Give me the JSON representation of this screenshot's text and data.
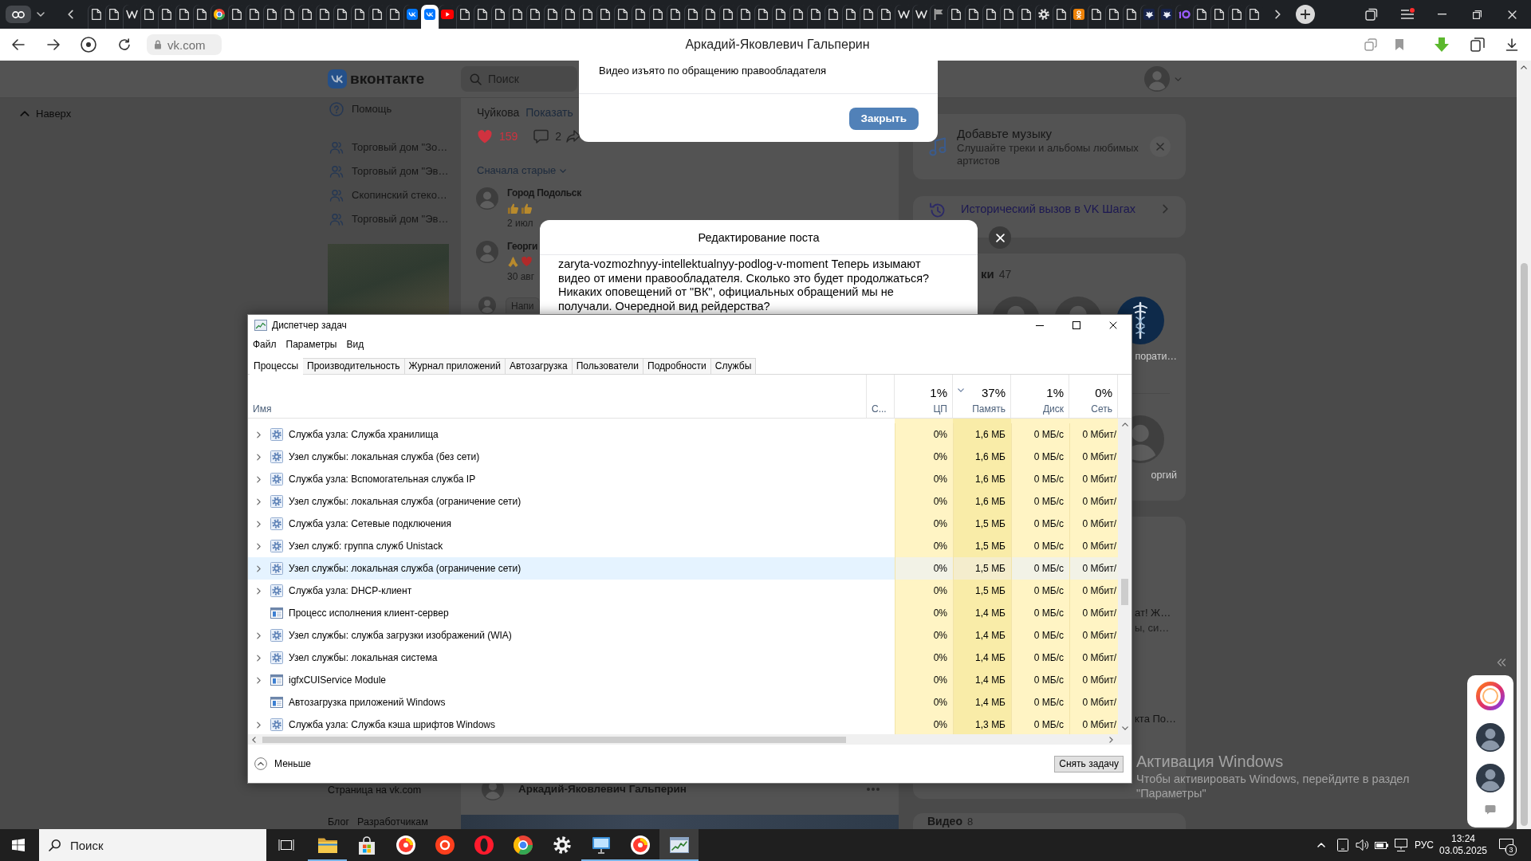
{
  "browser": {
    "tabs": [
      {
        "kind": "page",
        "selected": false
      },
      {
        "kind": "page",
        "selected": false
      },
      {
        "kind": "wiki",
        "selected": false
      },
      {
        "kind": "page",
        "selected": false
      },
      {
        "kind": "page",
        "selected": false
      },
      {
        "kind": "page",
        "selected": false
      },
      {
        "kind": "page",
        "selected": false
      },
      {
        "kind": "color",
        "selected": false
      },
      {
        "kind": "page",
        "selected": false
      },
      {
        "kind": "page",
        "selected": false
      },
      {
        "kind": "page",
        "selected": false
      },
      {
        "kind": "page",
        "selected": false
      },
      {
        "kind": "page",
        "selected": false
      },
      {
        "kind": "page",
        "selected": false
      },
      {
        "kind": "page",
        "selected": false
      },
      {
        "kind": "page",
        "selected": false
      },
      {
        "kind": "page",
        "selected": false
      },
      {
        "kind": "page",
        "selected": false
      },
      {
        "kind": "vk",
        "selected": false
      },
      {
        "kind": "vk",
        "selected": true
      },
      {
        "kind": "video",
        "selected": false
      },
      {
        "kind": "page",
        "selected": false
      },
      {
        "kind": "page",
        "selected": false
      },
      {
        "kind": "page",
        "selected": false
      },
      {
        "kind": "page",
        "selected": false
      },
      {
        "kind": "page",
        "selected": false
      },
      {
        "kind": "page",
        "selected": false
      },
      {
        "kind": "page",
        "selected": false
      },
      {
        "kind": "page",
        "selected": false
      },
      {
        "kind": "page",
        "selected": false
      },
      {
        "kind": "page",
        "selected": false
      },
      {
        "kind": "page",
        "selected": false
      },
      {
        "kind": "page",
        "selected": false
      },
      {
        "kind": "page",
        "selected": false
      },
      {
        "kind": "page",
        "selected": false
      },
      {
        "kind": "page",
        "selected": false
      },
      {
        "kind": "page",
        "selected": false
      },
      {
        "kind": "page",
        "selected": false
      },
      {
        "kind": "page",
        "selected": false
      },
      {
        "kind": "page",
        "selected": false
      },
      {
        "kind": "page",
        "selected": false
      },
      {
        "kind": "page",
        "selected": false
      },
      {
        "kind": "page",
        "selected": false
      },
      {
        "kind": "page",
        "selected": false
      },
      {
        "kind": "page",
        "selected": false
      },
      {
        "kind": "page",
        "selected": false
      },
      {
        "kind": "wiki",
        "selected": false
      },
      {
        "kind": "wiki",
        "selected": false
      },
      {
        "kind": "flag",
        "selected": false
      },
      {
        "kind": "page",
        "selected": false
      },
      {
        "kind": "page",
        "selected": false
      },
      {
        "kind": "page",
        "selected": false
      },
      {
        "kind": "page",
        "selected": false
      },
      {
        "kind": "page",
        "selected": false
      },
      {
        "kind": "gear",
        "selected": false
      },
      {
        "kind": "page",
        "selected": false
      },
      {
        "kind": "ok",
        "selected": false
      },
      {
        "kind": "page",
        "selected": false
      },
      {
        "kind": "page",
        "selected": false
      },
      {
        "kind": "page",
        "selected": false
      },
      {
        "kind": "emblem",
        "selected": false
      },
      {
        "kind": "emblem",
        "selected": false
      },
      {
        "kind": "loop",
        "selected": false
      },
      {
        "kind": "page",
        "selected": false
      },
      {
        "kind": "page",
        "selected": false
      },
      {
        "kind": "page",
        "selected": false
      },
      {
        "kind": "page",
        "selected": false
      }
    ],
    "address": "vk.com",
    "page_title": "Аркадий-Яковлевич Гальперин"
  },
  "vk": {
    "logo": "вконтакте",
    "search": {
      "placeholder": "Поиск"
    },
    "back_to_top": "Наверх",
    "menu": [
      {
        "kind": "help",
        "label": "Помощь"
      },
      {
        "kind": "group",
        "label": "Торговый дом \"Зо…"
      },
      {
        "kind": "group",
        "label": "Торговый дом \"Эв…"
      },
      {
        "kind": "group",
        "label": "Скопинский стеко…"
      },
      {
        "kind": "group",
        "label": "Торговый дом \"Эв…"
      }
    ],
    "footer_links": [
      [
        "Страница на vk.com"
      ],
      [
        "Блог",
        "Разработчикам"
      ]
    ],
    "post": {
      "text": "Чуйкова",
      "show_more": "Показать",
      "likes": "159",
      "liked": true,
      "comments": "2",
      "sort": "Сначала старые",
      "replies": [
        {
          "name": "Город Подольск",
          "reactions": [
            {
              "kind": "thumbs-up"
            },
            {
              "kind": "thumbs-up"
            }
          ],
          "date": "2 июл"
        },
        {
          "name": "Георги",
          "reactions": [
            {
              "kind": "folded-hands"
            },
            {
              "kind": "heart"
            }
          ],
          "date": "30 авг"
        }
      ],
      "reply_field": {
        "placeholder": "Напи"
      }
    },
    "next_post": {
      "author": "Аркадий-Яковлевич Гальперин"
    },
    "music_card": {
      "title": "Добавьте музыку",
      "text": "Слушайте треки и альбомы любимых артистов"
    },
    "steps_card": {
      "title": "Исторический вызов в VK Шагах"
    },
    "friends": {
      "title": "ки",
      "count": "47",
      "rows": [
        [
          {
            "kind": "photo"
          },
          {
            "kind": "photo"
          },
          {
            "kind": "emblem",
            "name": "порати…"
          }
        ],
        [
          {
            "kind": "photo",
            "name": "оргий"
          }
        ]
      ]
    },
    "feed_card": {
      "lines": [
        "ат! Ж…",
        "ы, си…"
      ],
      "footer": "кта По…"
    },
    "videos": {
      "title": "Видео",
      "count": "8"
    }
  },
  "video_dialog": {
    "message": "Видео изъято по обращению правообладателя",
    "button": "Закрыть"
  },
  "edit_dialog": {
    "title": "Редактирование поста",
    "text": "zaryta-vozmozhnyy-intellektualnyy-podlog-v-moment Теперь изымают видео от имени правообладателя. Сколько это будет продолжаться? Никаких оповещений от \"ВК\", официальных обращений мы не получали. Очередной вид рейдерства?"
  },
  "task_manager": {
    "title": "Диспетчер задач",
    "menu": [
      "Файл",
      "Параметры",
      "Вид"
    ],
    "tabs": [
      {
        "label": "Процессы",
        "selected": true
      },
      {
        "label": "Производительность",
        "selected": false
      },
      {
        "label": "Журнал приложений",
        "selected": false
      },
      {
        "label": "Автозагрузка",
        "selected": false
      },
      {
        "label": "Пользователи",
        "selected": false
      },
      {
        "label": "Подробности",
        "selected": false
      },
      {
        "label": "Службы",
        "selected": false
      }
    ],
    "columns": [
      {
        "label": "Имя",
        "sorted": false
      },
      {
        "label": "С...",
        "sorted": false
      },
      {
        "label": "ЦП",
        "usage": "1%",
        "sorted": false
      },
      {
        "label": "Память",
        "usage": "37%",
        "sorted": true
      },
      {
        "label": "Диск",
        "usage": "1%",
        "sorted": false
      },
      {
        "label": "Сеть",
        "usage": "0%",
        "sorted": false
      }
    ],
    "rows": [
      {
        "name": "Служба узла: Служба хранилища",
        "kind": "service",
        "expandable": true,
        "selected": false,
        "cpu": "0%",
        "memory": "1,6 МБ",
        "disk": "0 МБ/с",
        "network": "0 Мбит/"
      },
      {
        "name": "Узел службы: локальная служба (без сети)",
        "kind": "service",
        "expandable": true,
        "selected": false,
        "cpu": "0%",
        "memory": "1,6 МБ",
        "disk": "0 МБ/с",
        "network": "0 Мбит/"
      },
      {
        "name": "Служба узла: Вспомогательная служба IP",
        "kind": "service",
        "expandable": true,
        "selected": false,
        "cpu": "0%",
        "memory": "1,6 МБ",
        "disk": "0 МБ/с",
        "network": "0 Мбит/"
      },
      {
        "name": "Узел службы: локальная служба (ограничение сети)",
        "kind": "service",
        "expandable": true,
        "selected": false,
        "cpu": "0%",
        "memory": "1,6 МБ",
        "disk": "0 МБ/с",
        "network": "0 Мбит/"
      },
      {
        "name": "Служба узла: Сетевые подключения",
        "kind": "service",
        "expandable": true,
        "selected": false,
        "cpu": "0%",
        "memory": "1,5 МБ",
        "disk": "0 МБ/с",
        "network": "0 Мбит/"
      },
      {
        "name": "Узел служб: группа служб Unistack",
        "kind": "service",
        "expandable": true,
        "selected": false,
        "cpu": "0%",
        "memory": "1,5 МБ",
        "disk": "0 МБ/с",
        "network": "0 Мбит/"
      },
      {
        "name": "Узел службы: локальная служба (ограничение сети)",
        "kind": "service",
        "expandable": true,
        "selected": true,
        "cpu": "0%",
        "memory": "1,5 МБ",
        "disk": "0 МБ/с",
        "network": "0 Мбит/"
      },
      {
        "name": "Служба узла: DHCP-клиент",
        "kind": "service",
        "expandable": true,
        "selected": false,
        "cpu": "0%",
        "memory": "1,5 МБ",
        "disk": "0 МБ/с",
        "network": "0 Мбит/"
      },
      {
        "name": "Процесс исполнения клиент-сервер",
        "kind": "app",
        "expandable": false,
        "selected": false,
        "cpu": "0%",
        "memory": "1,4 МБ",
        "disk": "0 МБ/с",
        "network": "0 Мбит/"
      },
      {
        "name": "Узел службы: служба загрузки изображений (WIA)",
        "kind": "service",
        "expandable": true,
        "selected": false,
        "cpu": "0%",
        "memory": "1,4 МБ",
        "disk": "0 МБ/с",
        "network": "0 Мбит/"
      },
      {
        "name": "Узел службы: локальная система",
        "kind": "service",
        "expandable": true,
        "selected": false,
        "cpu": "0%",
        "memory": "1,4 МБ",
        "disk": "0 МБ/с",
        "network": "0 Мбит/"
      },
      {
        "name": "igfxCUIService Module",
        "kind": "app",
        "expandable": true,
        "selected": false,
        "cpu": "0%",
        "memory": "1,4 МБ",
        "disk": "0 МБ/с",
        "network": "0 Мбит/"
      },
      {
        "name": "Автозагрузка приложений Windows",
        "kind": "app",
        "expandable": false,
        "selected": false,
        "cpu": "0%",
        "memory": "1,4 МБ",
        "disk": "0 МБ/с",
        "network": "0 Мбит/"
      },
      {
        "name": "Служба узла: Служба кэша шрифтов Windows",
        "kind": "service",
        "expandable": true,
        "selected": false,
        "cpu": "0%",
        "memory": "1,3 МБ",
        "disk": "0 МБ/с",
        "network": "0 Мбит/"
      }
    ],
    "fewer_details": "Меньше",
    "end_task": "Снять задачу"
  },
  "browser_sidebar": {
    "items": [
      {
        "kind": "assistant"
      },
      {
        "kind": "avatar"
      },
      {
        "kind": "avatar"
      },
      {
        "kind": "chat"
      }
    ]
  },
  "activation": {
    "title": "Активация Windows",
    "text": "Чтобы активировать Windows, перейдите в раздел \"Параметры\""
  },
  "taskbar": {
    "search": {
      "placeholder": "Поиск"
    },
    "apps": [
      {
        "kind": "explorer",
        "running": true,
        "active": false
      },
      {
        "kind": "store",
        "running": false,
        "active": false
      },
      {
        "kind": "yandex-browser",
        "running": false,
        "active": false
      },
      {
        "kind": "yandex",
        "running": false,
        "active": false
      },
      {
        "kind": "opera",
        "running": false,
        "active": false
      },
      {
        "kind": "chrome",
        "running": false,
        "active": false
      },
      {
        "kind": "settings",
        "running": false,
        "active": false
      },
      {
        "kind": "monitor",
        "running": true,
        "active": false
      },
      {
        "kind": "yandex-browser",
        "running": true,
        "active": false
      },
      {
        "kind": "task-manager",
        "running": true,
        "active": true
      }
    ],
    "language": "РУС",
    "time": "13:24",
    "date": "03.05.2025",
    "notifications": "3"
  }
}
